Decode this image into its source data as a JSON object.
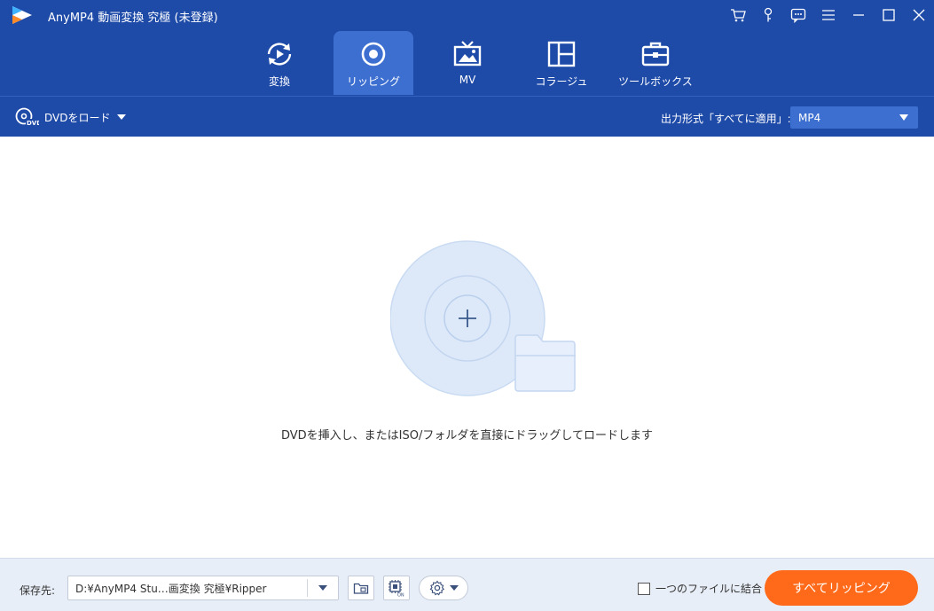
{
  "app": {
    "title": "AnyMP4 動画変換 究極 (未登録)",
    "icons": [
      "cart-icon",
      "key-icon",
      "feedback-icon",
      "menu-icon",
      "minimize-icon",
      "maximize-icon",
      "close-icon"
    ]
  },
  "nav": {
    "tabs": [
      {
        "label": "変換",
        "icon": "convert-icon",
        "active": false
      },
      {
        "label": "リッピング",
        "icon": "ripper-icon",
        "active": true
      },
      {
        "label": "MV",
        "icon": "mv-icon",
        "active": false
      },
      {
        "label": "コラージュ",
        "icon": "collage-icon",
        "active": false
      },
      {
        "label": "ツールボックス",
        "icon": "toolbox-icon",
        "active": false
      }
    ]
  },
  "toolbar": {
    "load_dvd_label": "DVDをロード",
    "output_format_label": "出力形式「すべてに適用」:",
    "output_format_value": "MP4"
  },
  "main": {
    "hint": "DVDを挿入し、またはISO/フォルダを直接にドラッグしてロードします"
  },
  "bottom": {
    "save_label": "保存先:",
    "save_path": "D:¥AnyMP4 Stu…画変換 究極¥Ripper",
    "merge_label": "一つのファイルに結合",
    "merge_checked": false,
    "rip_all_label": "すべてリッピング"
  },
  "colors": {
    "header": "#1e4aa8",
    "tab_active": "#3d6fd1",
    "accent_orange": "#ff6a1a",
    "disc_fill": "#dde9f9",
    "disc_stroke": "#c4d6ef"
  }
}
